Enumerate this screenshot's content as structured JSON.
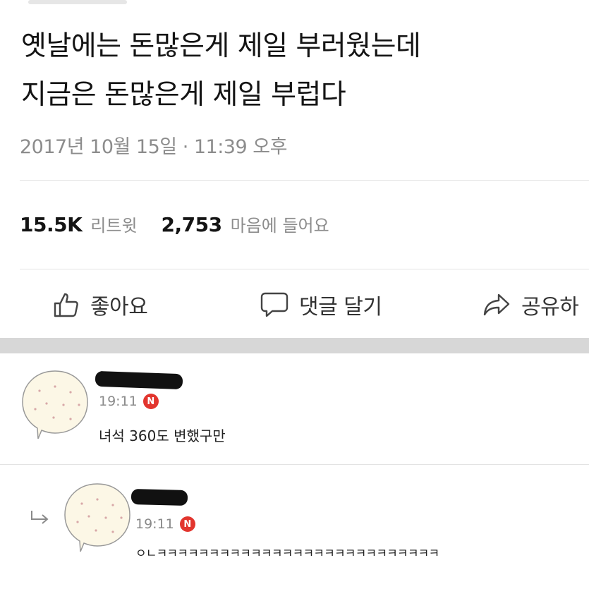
{
  "post": {
    "line1": "옛날에는 돈많은게 제일 부러웠는데",
    "line2": "지금은 돈많은게 제일 부럽다",
    "timestamp": "2017년 10월 15일 · 11:39 오후"
  },
  "stats": {
    "retweets_count": "15.5K",
    "retweets_label": "리트윗",
    "likes_count": "2,753",
    "likes_label": "마음에 들어요"
  },
  "actions": {
    "like": "좋아요",
    "comment": "댓글 달기",
    "share": "공유하"
  },
  "comments": [
    {
      "time": "19:11",
      "badge": "N",
      "text": "녀석 360도 변했구만"
    },
    {
      "time": "19:11",
      "badge": "N",
      "text": "ㅇㄴㅋㅋㅋㅋㅋㅋㅋㅋㅋㅋㅋㅋㅋㅋㅋㅋㅋㅋㅋㅋㅋㅋㅋㅋㅋㅋㅋ"
    }
  ],
  "colors": {
    "divider": "#e3e3e3",
    "band": "#d7d7d7",
    "badge": "#e2352e",
    "muted": "#8c8c8c"
  }
}
